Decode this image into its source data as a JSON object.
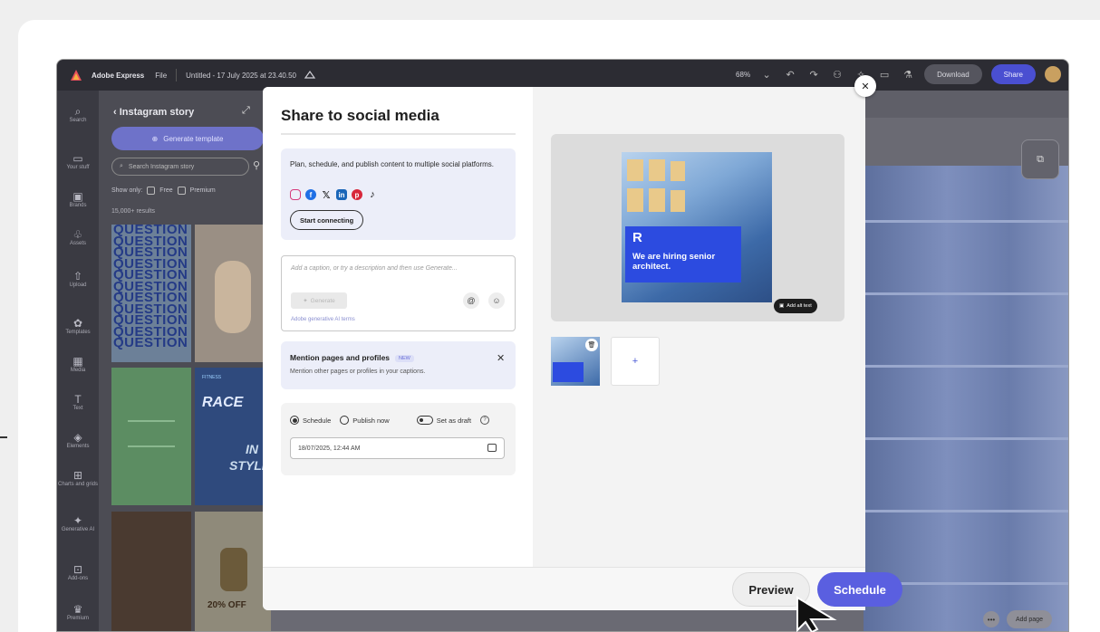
{
  "topbar": {
    "brand": "Adobe Express",
    "file_menu": "File",
    "doc_title": "Untitled - 17 July 2025 at 23.40.50",
    "zoom": "68%",
    "download": "Download",
    "share": "Share"
  },
  "rail": {
    "items": [
      {
        "label": "Search",
        "icon": "search-icon"
      },
      {
        "label": "Your stuff",
        "icon": "folder-icon"
      },
      {
        "label": "Brands",
        "icon": "brand-icon"
      },
      {
        "label": "Assets",
        "icon": "assets-icon"
      },
      {
        "label": "Upload",
        "icon": "upload-icon"
      },
      {
        "label": "Templates",
        "icon": "templates-icon"
      },
      {
        "label": "Media",
        "icon": "media-icon"
      },
      {
        "label": "Text",
        "icon": "text-icon"
      },
      {
        "label": "Elements",
        "icon": "elements-icon"
      },
      {
        "label": "Charts and grids",
        "icon": "charts-icon"
      },
      {
        "label": "Generative AI",
        "icon": "generative-icon"
      },
      {
        "label": "Add-ons",
        "icon": "addons-icon"
      },
      {
        "label": "Premium",
        "icon": "premium-icon"
      }
    ]
  },
  "panel": {
    "title": "Instagram story",
    "generate": "Generate template",
    "search_placeholder": "Search Instagram story",
    "show_only": "Show only:",
    "free": "Free",
    "premium": "Premium",
    "results": "15,000+ results",
    "question_word": "QUESTION",
    "race": "RACE",
    "fitness": "FITNESS",
    "in_word": "IN",
    "style_word": "STYLE",
    "off": "20% OFF"
  },
  "canvas": {
    "add_page": "Add page"
  },
  "modal": {
    "title": "Share to social media",
    "connect_desc": "Plan, schedule, and publish content to multiple social platforms.",
    "start_connecting": "Start connecting",
    "caption_placeholder": "Add a caption, or try a description and then use Generate...",
    "generate": "Generate",
    "ai_terms": "Adobe generative AI terms",
    "mention_title": "Mention pages and profiles",
    "mention_new": "NEW",
    "mention_desc": "Mention other pages or profiles in your captions.",
    "schedule_option": "Schedule",
    "publish_now": "Publish now",
    "set_as_draft": "Set as draft",
    "date_value": "18/07/2025, 12:44 AM",
    "post_heading_r": "R",
    "post_heading": "We are hiring senior architect.",
    "add_alt_text": "Add alt text",
    "add_thumb": "+",
    "preview": "Preview",
    "schedule": "Schedule"
  },
  "colors": {
    "accent": "#5a5fe0",
    "topbar_bg": "#2c2c33",
    "card_bg": "#eceef9",
    "post_badge": "#2c4be0"
  }
}
